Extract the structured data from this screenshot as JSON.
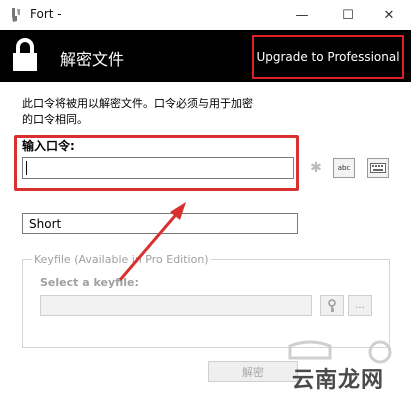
{
  "window": {
    "title": "Fort -",
    "minimize": "—",
    "maximize": "☐",
    "close": "✕"
  },
  "header": {
    "title": "解密文件",
    "upgrade_button": "Upgrade to Professional",
    "background": "#000000"
  },
  "description": "此口令将被用以解密文件。口令必须与用于加密的口令相同。",
  "password": {
    "label": "输入口令:",
    "value": ""
  },
  "side_icons": {
    "abc": "abc"
  },
  "strength": "Short",
  "keyfile": {
    "group_label": "Keyfile (Available in Pro Edition)",
    "select_label": "Select a keyfile:",
    "value": "",
    "browse_label": "..."
  },
  "decrypt_button": "解密",
  "watermark": "云南龙网",
  "colors": {
    "annotation_red": "#d93030",
    "disabled_text": "#a0a0a0"
  },
  "icons": [
    "app-icon",
    "lock-icon",
    "star-icon",
    "abc-icon",
    "keyboard-icon",
    "key-icon"
  ]
}
